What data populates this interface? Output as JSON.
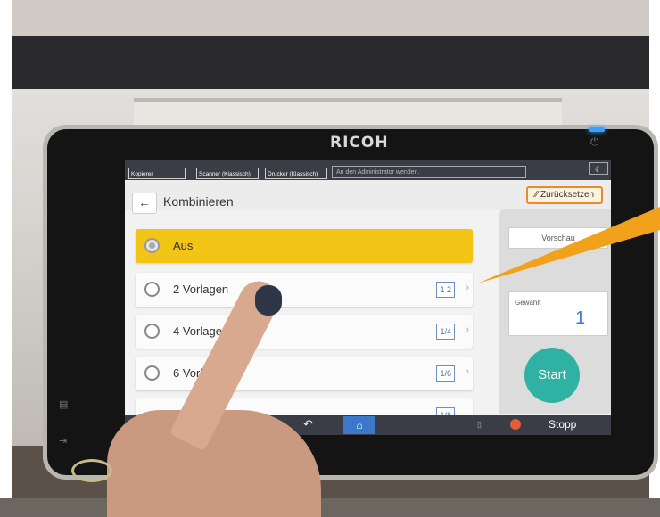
{
  "device": {
    "brand": "RICOH"
  },
  "topbar": {
    "tabs": [
      "Kopierer (Klassisch)",
      "Scanner (Klassisch)",
      "Drucker (Klassisch)"
    ],
    "message": "An den Administrator wenden."
  },
  "header": {
    "title": "Kombinieren",
    "reset_label": "Zurücksetzen"
  },
  "options": [
    {
      "label": "Aus",
      "selected": true,
      "icon": ""
    },
    {
      "label": "2 Vorlagen",
      "selected": false,
      "icon": "1 2"
    },
    {
      "label": "4 Vorlagen",
      "selected": false,
      "icon": "1/4"
    },
    {
      "label": "6 Vorlagen",
      "selected": false,
      "icon": "1/6"
    },
    {
      "label": "",
      "selected": false,
      "icon": "1/8"
    }
  ],
  "right_panel": {
    "preview_label": "Vorschau",
    "selected_label": "Gewählt",
    "selected_count": "1",
    "start_label": "Start"
  },
  "bottombar": {
    "stop_label": "Stopp"
  },
  "colors": {
    "accent_yellow": "#f2c416",
    "start_teal": "#2fb1a4",
    "reset_orange": "#e88b2a",
    "home_blue": "#3b78c9"
  }
}
